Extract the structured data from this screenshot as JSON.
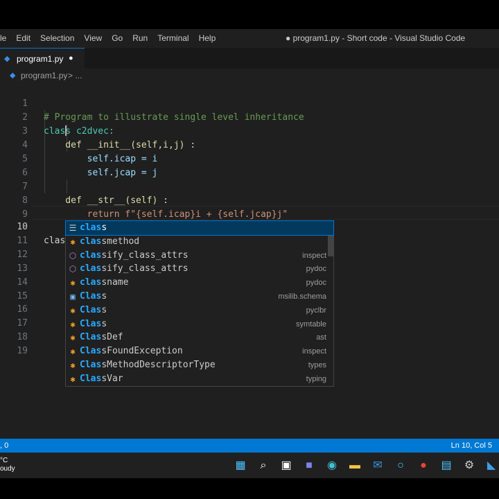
{
  "window": {
    "title": "● program1.py - Short code - Visual Studio Code",
    "menu": [
      "le",
      "Edit",
      "Selection",
      "View",
      "Go",
      "Run",
      "Terminal",
      "Help"
    ]
  },
  "tab": {
    "label": "program1.py",
    "modified_indicator": "●"
  },
  "breadcrumb": {
    "file": "program1.py",
    "rest": "> ..."
  },
  "editor": {
    "line_numbers": [
      "1",
      "2",
      "3",
      "4",
      "5",
      "6",
      "7",
      "8",
      "9",
      "10",
      "11",
      "12",
      "13",
      "14",
      "15",
      "16",
      "17",
      "18",
      "19"
    ],
    "lines": [
      "# Program to illustrate single level inheritance",
      "class c2dvec:",
      "    def __init__(self,i,j) :",
      "        self.icap = i",
      "        self.jcap = j",
      "",
      "    def __str__(self) :",
      "        return f\"{self.icap}i + {self.jcap}j\"",
      "",
      "clas"
    ]
  },
  "suggestions": [
    {
      "match": "clas",
      "rest": "s",
      "detail": "",
      "icon": "keyword-icon",
      "selected": true
    },
    {
      "match": "clas",
      "rest": "smethod",
      "detail": "",
      "icon": "class-icon"
    },
    {
      "match": "clas",
      "rest": "sify_class_attrs",
      "detail": "inspect",
      "icon": "method-icon"
    },
    {
      "match": "clas",
      "rest": "sify_class_attrs",
      "detail": "pydoc",
      "icon": "method-icon"
    },
    {
      "match": "clas",
      "rest": "sname",
      "detail": "pydoc",
      "icon": "class-icon"
    },
    {
      "match": "Clas",
      "rest": "s",
      "detail": "msilib.schema",
      "icon": "variable-icon"
    },
    {
      "match": "Clas",
      "rest": "s",
      "detail": "pyclbr",
      "icon": "class-icon"
    },
    {
      "match": "Clas",
      "rest": "s",
      "detail": "symtable",
      "icon": "class-icon"
    },
    {
      "match": "Clas",
      "rest": "sDef",
      "detail": "ast",
      "icon": "class-icon"
    },
    {
      "match": "Clas",
      "rest": "sFoundException",
      "detail": "inspect",
      "icon": "class-icon"
    },
    {
      "match": "Clas",
      "rest": "sMethodDescriptorType",
      "detail": "types",
      "icon": "class-icon"
    },
    {
      "match": "Clas",
      "rest": "sVar",
      "detail": "typing",
      "icon": "class-icon"
    }
  ],
  "statusbar": {
    "left": ", 0",
    "right": "Ln 10, Col 5"
  },
  "taskbar": {
    "weather_temp": "°C",
    "weather_desc": "oudy",
    "icons": [
      "windows-start-icon",
      "search-icon",
      "task-view-icon",
      "teams-chat-icon",
      "edge-icon",
      "file-explorer-icon",
      "mail-icon",
      "cortana-icon",
      "chrome-icon",
      "notepad-icon",
      "settings-icon",
      "vscode-icon"
    ]
  },
  "colors": {
    "editor_bg": "#1f1f1f",
    "statusbar_bg": "#0078d4",
    "keyword": "#569cd6",
    "comment": "#6a9955",
    "string": "#ce9178",
    "function": "#dcdcaa",
    "class_name": "#4ec9b0",
    "variable": "#9cdcfe"
  }
}
